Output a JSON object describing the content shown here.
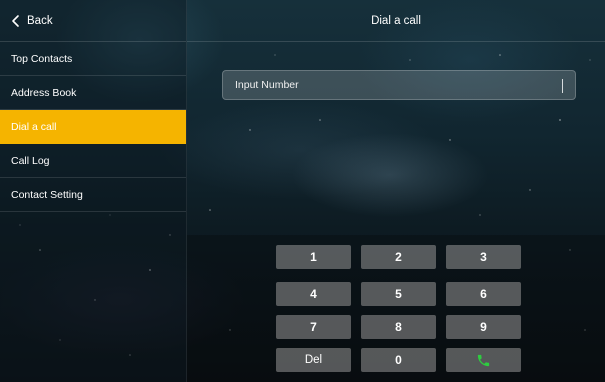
{
  "header": {
    "back_label": "Back",
    "title": "Dial a call"
  },
  "sidebar": {
    "items": [
      {
        "label": "Top Contacts",
        "active": false
      },
      {
        "label": "Address Book",
        "active": false
      },
      {
        "label": "Dial a call",
        "active": true
      },
      {
        "label": "Call Log",
        "active": false
      },
      {
        "label": "Contact Setting",
        "active": false
      }
    ]
  },
  "dial_input": {
    "placeholder": "Input Number",
    "value": ""
  },
  "keypad": {
    "keys": [
      "1",
      "2",
      "3",
      "4",
      "5",
      "6",
      "7",
      "8",
      "9",
      "Del",
      "0"
    ],
    "call_icon": "phone-call-icon"
  },
  "colors": {
    "accent": "#f5b400",
    "call_green": "#2ecc40"
  }
}
